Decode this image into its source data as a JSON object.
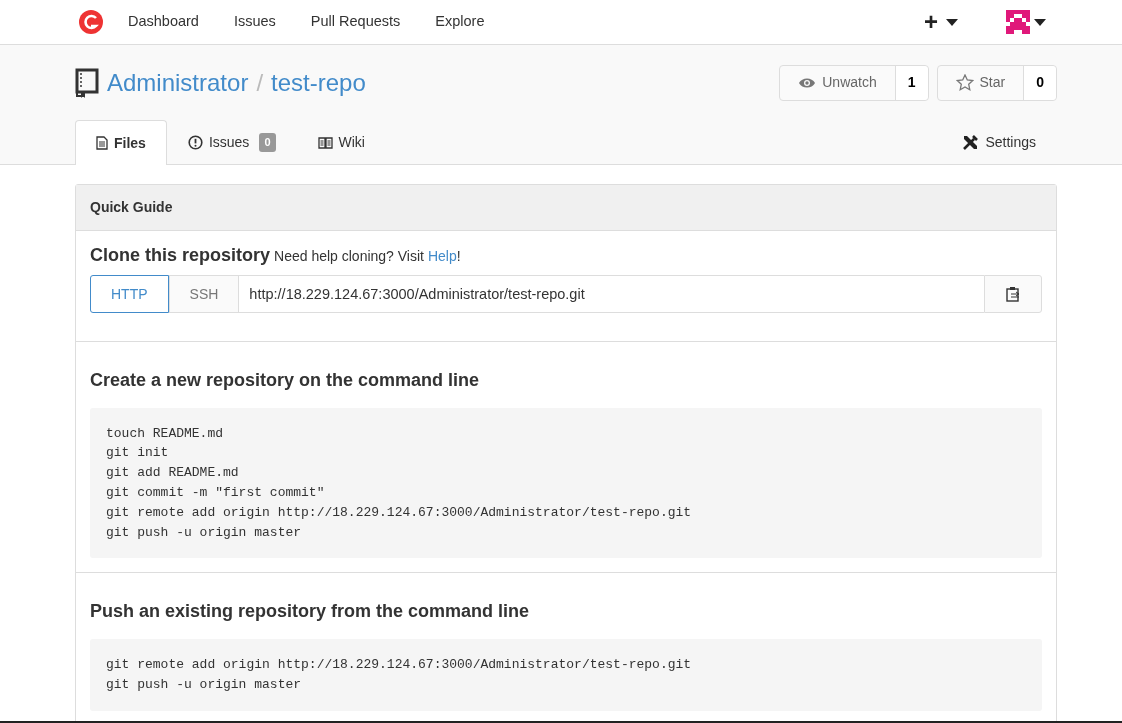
{
  "navbar": {
    "items": [
      {
        "label": "Dashboard"
      },
      {
        "label": "Issues"
      },
      {
        "label": "Pull Requests"
      },
      {
        "label": "Explore"
      }
    ],
    "create_label": "+"
  },
  "repo": {
    "owner": "Administrator",
    "separator": "/",
    "name": "test-repo",
    "watch": {
      "label": "Unwatch",
      "count": "1"
    },
    "star": {
      "label": "Star",
      "count": "0"
    }
  },
  "tabs": [
    {
      "kind": "files",
      "label": "Files",
      "selected": true
    },
    {
      "kind": "issues",
      "label": "Issues",
      "badge": "0",
      "selected": false
    },
    {
      "kind": "wiki",
      "label": "Wiki",
      "selected": false
    }
  ],
  "settings_label": "Settings",
  "guide": {
    "title": "Quick Guide",
    "clone": {
      "heading": "Clone this repository",
      "help_text": "Need help cloning? Visit ",
      "help_link": "Help",
      "help_suffix": "!",
      "protocols": [
        {
          "label": "HTTP",
          "selected": true
        },
        {
          "label": "SSH",
          "selected": false
        }
      ],
      "url": "http://18.229.124.67:3000/Administrator/test-repo.git"
    },
    "sections": [
      {
        "heading": "Create a new repository on the command line",
        "code": [
          "touch README.md",
          "git init",
          "git add README.md",
          "git commit -m \"first commit\"",
          "git remote add origin http://18.229.124.67:3000/Administrator/test-repo.git",
          "git push -u origin master"
        ]
      },
      {
        "heading": "Push an existing repository from the command line",
        "code": [
          "git remote add origin http://18.229.124.67:3000/Administrator/test-repo.git",
          "git push -u origin master"
        ]
      }
    ]
  }
}
